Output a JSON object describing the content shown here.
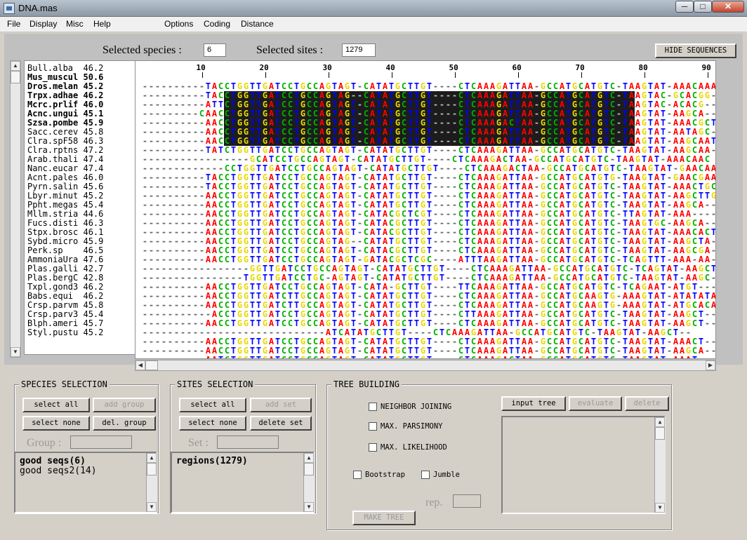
{
  "window": {
    "title": "DNA.mas",
    "min": "─",
    "max": "□",
    "close": "✕"
  },
  "menu": [
    "File",
    "Display",
    "Misc",
    "Help",
    "Options",
    "Coding",
    "Distance"
  ],
  "header": {
    "species_label": "Selected species :",
    "species_value": "6",
    "sites_label": "Selected sites :",
    "sites_value": "1279",
    "hide_button": "HIDE SEQUENCES"
  },
  "ruler": [
    "10",
    "20",
    "30",
    "40",
    "50",
    "60",
    "70",
    "80",
    "90"
  ],
  "species": [
    {
      "name": "Bull.alba",
      "score": "46.2",
      "bold": false
    },
    {
      "name": "Mus_muscul",
      "score": "50.6",
      "bold": true
    },
    {
      "name": "Dros.melan",
      "score": "45.2",
      "bold": true
    },
    {
      "name": "Trpx.adhae",
      "score": "46.2",
      "bold": true
    },
    {
      "name": "Mcrc.prlif",
      "score": "46.0",
      "bold": true
    },
    {
      "name": "Acnc.ungui",
      "score": "45.1",
      "bold": true
    },
    {
      "name": "Szsa.pombe",
      "score": "45.9",
      "bold": true
    },
    {
      "name": "Sacc.cerev",
      "score": "45.8",
      "bold": false
    },
    {
      "name": "Clra.spF58",
      "score": "46.3",
      "bold": false
    },
    {
      "name": "Clra.rptns",
      "score": "47.2",
      "bold": false
    },
    {
      "name": "Arab.thali",
      "score": "47.4",
      "bold": false
    },
    {
      "name": "Nanc.eucar",
      "score": "47.4",
      "bold": false
    },
    {
      "name": "Acnt.pales",
      "score": "46.0",
      "bold": false
    },
    {
      "name": "Pyrn.salin",
      "score": "45.6",
      "bold": false
    },
    {
      "name": "Lbyr.minut",
      "score": "45.2",
      "bold": false
    },
    {
      "name": "Ppht.megas",
      "score": "45.4",
      "bold": false
    },
    {
      "name": "Mllm.stria",
      "score": "44.6",
      "bold": false
    },
    {
      "name": "Fucs.disti",
      "score": "46.3",
      "bold": false
    },
    {
      "name": "Stpx.brosc",
      "score": "46.1",
      "bold": false
    },
    {
      "name": "Sybd.micro",
      "score": "45.9",
      "bold": false
    },
    {
      "name": "Perk.sp",
      "score": "46.5",
      "bold": false
    },
    {
      "name": "AmmoniaUra",
      "score": "47.6",
      "bold": false
    },
    {
      "name": "Plas.galli",
      "score": "42.7",
      "bold": false
    },
    {
      "name": "Plas.bergC",
      "score": "42.8",
      "bold": false
    },
    {
      "name": "Txpl.gond3",
      "score": "46.2",
      "bold": false
    },
    {
      "name": "Babs.equi",
      "score": "46.2",
      "bold": false
    },
    {
      "name": "Crsp.parvm",
      "score": "45.8",
      "bold": false
    },
    {
      "name": "Crsp.parv3",
      "score": "45.4",
      "bold": false
    },
    {
      "name": "Blph.ameri",
      "score": "45.7",
      "bold": false
    },
    {
      "name": "Styl.pustu",
      "score": "45.2",
      "bold": false
    }
  ],
  "sequences": [
    "----------TACCTGGTTGATCCTGCCAGTAGT-CATATGCTTGT----CTCAAAGATTAA-GCCATGCATGTC-TAAGTAT-AAACAAA",
    "----------TACCTGGTTGATCCTGCCAGTAG--CATATGCTTGT----CTCAAAGATTAA-GCCATGCATGTC-TAAGTAC-GCACGG-",
    "----------ATTCTGGTTGATCCTGCCAGTAGT-CATATGCTTGT----CTCAAAGATTAA-GCCATGCATGTC-TAAGTAC-ACACG--",
    "---------CAACCTGGTTGATCCTGCCAGTAGT-CATATGCTTGT----CTCAAAGATTAA-GCCATGCATGTC-TAAGTAT-AAGCA--",
    "----------AACCTGGTTGATCCTGCCAGTAGT-CATATGCTTGT----CTCAAAGACTAA-GCCATGCATGTC-TAAGTAT-AAACGCT",
    "----------AACCTGGTTGATCCTGCCAGTAGT-CATATGCTTGT----CTCAAAGATTAA-GCCATGCATGTC-TAAGTAT-AATAGC-",
    "----------AACCTGGTTGATCCTGCCAGTAGT-CATATGCTTGT----CTCAAAGATTAA-GCCATGCATGTC-TAAGTAT-AAGCAAT",
    "----------TATCTGGTTGATCCTGCCAGTAGT-CATATGCTTGT----CTCAAAGATTAA-GCCATGCATGTC-TAAGTAT-AAGCAA-",
    "-----------------GCATCCTGCCAGTAGT-CATATGCTTGT----CTCAAAGACTAA-GCCATGCATGTC-TAAGTAT-AAACAAC",
    "-------------CCTGGTTGATCCTGCCAGTAGT-CATATGCTTGT----CTCAAAGACTAA-GCCATGCATGTC-TAAGTAT-GAACAAC",
    "----------TACCTGGTTGATCCTGCCAGTAGT-CATATGCTTGT----CTCAAAGATTAA-GCCATGCATGTG-TAAGTAT-GAACGAA",
    "----------TACCTGGTTGATCCTGCCAGTAGT-CATATGCTTGT----CTCAAAGATTAA-GCCATGCATGTC-TAAGTAT-AAACTGC",
    "----------AACCTGGTTGATCCTGCCAGTAGT-CATATGCTTGT----CTCAAAGATTAA-GCCATGCATGTC-TAAGTAT-AAGCTTG",
    "----------AACCTGGTTGATCCTGCCAGTAGT-CATATGCTTGT----CTCAAAGATTAA-GCCATGCATGTC-TAAGTAT-AAGCA--",
    "----------AACCTGGTTGATCCTGCCAGTAGT-CATACGCTCGT----CTCAAAGATTAA-GCCATGCATGTC-TTAGTAT-AAA----",
    "----------AACCTGGTTGATCCTGCCAGTAGT-CATACGCTTGT----CTCAAAGATTAA-GCCATGCATGTC-TAAGTGC-AAGCA--",
    "----------AACCTGGTTGATCCTGCCAGTAGT-CATACGCTTGT----CTCAAAGATTAA-GCCATGCATGTC-TAAGTAT-AAACACT",
    "----------AACCTGGTTGATCCTGCCAGTAG--CATATGCTTGT----CTCAAAGATTAA-GCCATGCATGTC-TAAGTAT-AAGCTA-",
    "----------AACCTGGTTGATCCTGCCAGTAGT-CATACGCTTGT----CTCAAAGATTAA-GCCATGCATGTC-TAAGTAT-AAGCGA-",
    "----------AACCTGGTTGATCCTGCCAGTAGT-GATACGCTCGC----ATTTAAGATTAA-GCCATGCATGTC-TCAGTTT-AAA-AA-",
    "-----------------GGTTGATCCTGCCAGTAGT-CATATGCTTGT----CTCAAAGATTAA-GCCATGCATGTC-TCAGTAT-AAGCT--",
    "----------------TGGTTGATCCTGC-AGTAGT-CATATGCTTGT----CTCAAAGATTAA-GCCATGCATGTC-TAAGTAT-AAGC---",
    "----------AACCTGGTTGATCCTGCCAGTAGT-CATA-GCTTGT----TTCAAAGATTAA-GCCATGCATGTC-TCAGAAT-ATGT---",
    "----------AACCTGGTTGATCTTGCCAGTAGT-CATATGCTTGT----CTCAAAGATTAA-GCCATGCAAGTG-AAAGTAT-ATATATA",
    "----------AACCTGGTTGATCTTGCCAGTAGT-CATATGCTTGT----CTCAAAGATTAA-GCCATGCAAGTG-AAAGTAT-ATGCACA",
    "-----------ACCTGGTTGATCCTGCCAGTAGT-CATATGCTTGT----CTTAAAGATTAA-GCCATGCATGTC-TAAGTAT-AAGCT--",
    "----------AACCTGGTTGATCCTGCCAGTAGT-CATATGCTTGT----CTCAAAGATTAA-GCCATGCATGTC-TAAGTAT-AAGCT--",
    "-----------------------------ATCATATGCTTGT----CTCAAAGATTAA-GCCATGCATGTC-TAAGTAT-AAGCT--",
    "----------AACCTGGTTGATCCTGCCAGTAGT-CATATGCTTGT----CTCAAAGATTAA-GCCATGCATGTC-TAAGTAT-AAACT--",
    "----------AACCTGGTTGATCCTGCCAGTAGT-CATATGCTTGT----CTCAAAGATTAA-GCCATGCATGTC-TAAGTAT-AAGCA--",
    "----------AATCTGGTTGATCCTGCCAGTAGT-CATATGCTTGT----CTCAAAGACTAA-GCCATGCATGTC-TAAGTAT-AAAT---"
  ],
  "highlight_rows": [
    1,
    6
  ],
  "highlight_cols": [
    [
      13,
      49
    ],
    [
      50,
      77
    ]
  ],
  "base_colors": {
    "A": "#ff0000",
    "C": "#00b000",
    "G": "#e8d800",
    "T": "#0000ff",
    "-": "#000000",
    "N": "#ffffff"
  },
  "species_selection": {
    "title": "SPECIES SELECTION",
    "select_all": "select all",
    "add_group": "add group",
    "select_none": "select none",
    "del_group": "del. group",
    "group_label": "Group :",
    "groups": [
      "good seqs(6)",
      "good seqs2(14)"
    ]
  },
  "sites_selection": {
    "title": "SITES SELECTION",
    "select_all": "select all",
    "add_set": "add set",
    "select_none": "select none",
    "delete_set": "delete set",
    "set_label": "Set :",
    "sets": [
      "regions(1279)"
    ]
  },
  "tree_building": {
    "title": "TREE BUILDING",
    "methods": [
      "NEIGHBOR  JOINING",
      "MAX. PARSIMONY",
      "MAX. LIKELIHOOD"
    ],
    "bootstrap": "Bootstrap",
    "jumble": "Jumble",
    "rep_label": "rep.",
    "make_tree": "MAKE  TREE",
    "input_tree": "input tree",
    "evaluate": "evaluate",
    "delete": "delete"
  }
}
